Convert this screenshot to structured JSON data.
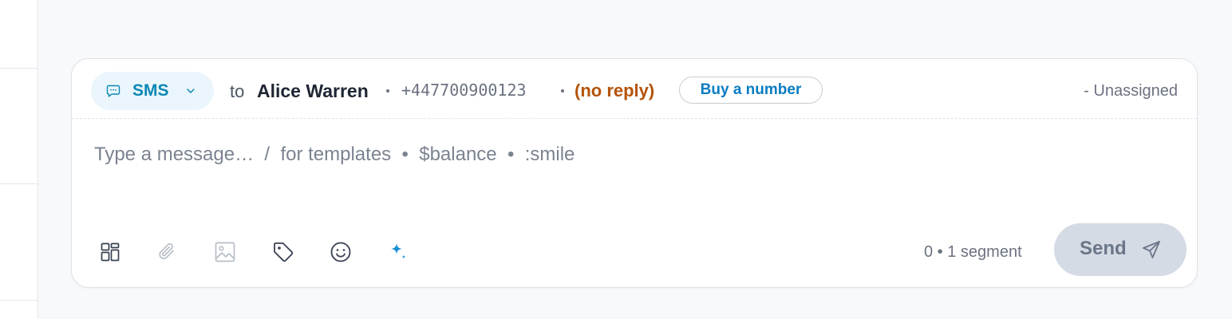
{
  "header": {
    "channel_label": "SMS",
    "to_word": "to",
    "contact_name": "Alice Warren",
    "phone": "+447700900123",
    "reply_status": "(no reply)",
    "buy_number_label": "Buy a number",
    "assignee": "- Unassigned"
  },
  "composer": {
    "placeholder": "Type a message…  /  for templates  •  $balance  •  :smile"
  },
  "footer": {
    "counter": "0 • 1 segment",
    "send_label": "Send"
  },
  "colors": {
    "accent": "#0b87b4",
    "link": "#0b7cc1",
    "warning": "#b45309",
    "send_disabled_bg": "#d4dbe5",
    "ai_sparkle": "#1b8fd0"
  },
  "icons": [
    "chat-bubble-icon",
    "chevron-down-icon",
    "templates-grid-icon",
    "paperclip-icon",
    "image-icon",
    "tag-icon",
    "emoji-smile-icon",
    "ai-sparkle-icon",
    "send-plane-icon"
  ]
}
